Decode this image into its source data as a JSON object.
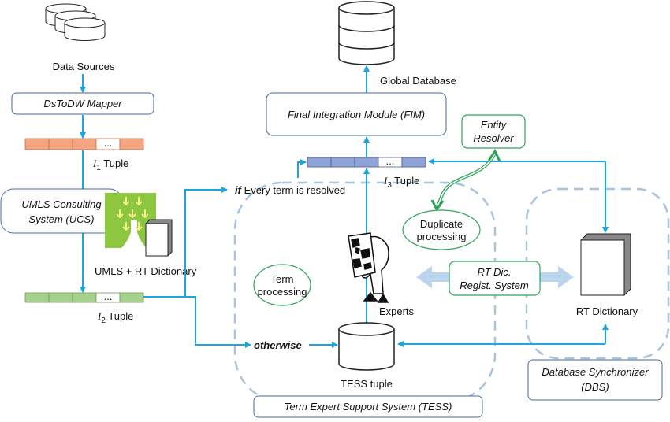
{
  "sources": {
    "label": "Data Sources"
  },
  "mapper": {
    "label": "DsToDW Mapper"
  },
  "tuple1": {
    "cell_ellipsis": "...",
    "letter": "I",
    "sub": "1",
    "suffix": " Tuple",
    "color": "#f4a582"
  },
  "ucs": {
    "line1": "UMLS Consulting",
    "line2": "System (UCS)"
  },
  "umls": {
    "label": "UMLS + RT Dictionary"
  },
  "tuple2": {
    "cell_ellipsis": "...",
    "letter": "I",
    "sub": "2",
    "suffix": " Tuple",
    "color": "#a8d08d"
  },
  "branch": {
    "if_kw": "if",
    "if_text": " Every term is resolved",
    "otherwise": "otherwise"
  },
  "global_db": {
    "label": "Global Database"
  },
  "fim": {
    "label": "Final Integration Module (FIM)"
  },
  "entity_resolver": {
    "line1": "Entity",
    "line2": "Resolver"
  },
  "tuple3": {
    "cell_ellipsis": "...",
    "letter": "I",
    "sub": "3",
    "suffix": " Tuple",
    "color": "#8fa3d8"
  },
  "duplicate": {
    "line1": "Duplicate",
    "line2": "processing"
  },
  "term": {
    "line1": "Term",
    "line2": "processing"
  },
  "experts": {
    "label": "Experts"
  },
  "regist": {
    "line1": "RT Dic.",
    "line2": "Regist. System"
  },
  "rt_dict": {
    "label": "RT Dictionary"
  },
  "tess_tuple": {
    "label": "TESS tuple"
  },
  "tess": {
    "label": "Term Expert Support System (TESS)"
  },
  "dbs": {
    "line1": "Database Synchronizer",
    "line2": "(DBS)"
  },
  "colors": {
    "arrow": "#1aa7e0",
    "green": "#2ea55a",
    "dashed": "#a9c3df",
    "box_border": "#4a6a9a"
  }
}
